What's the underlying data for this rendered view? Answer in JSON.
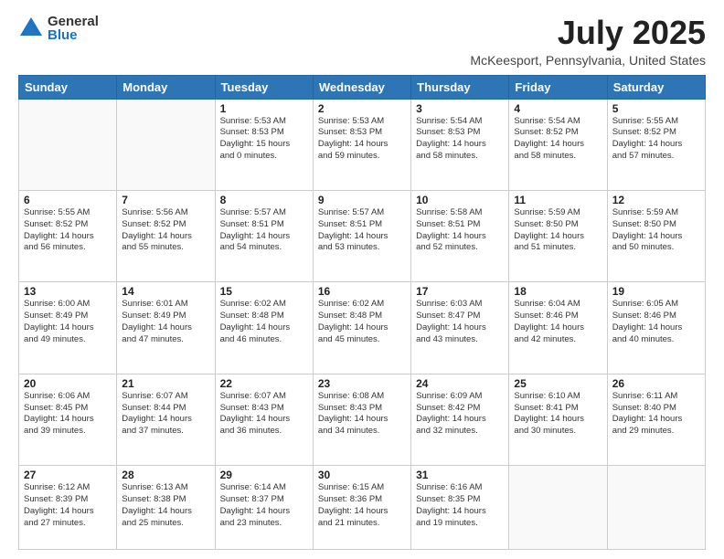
{
  "logo": {
    "general": "General",
    "blue": "Blue"
  },
  "title": "July 2025",
  "subtitle": "McKeesport, Pennsylvania, United States",
  "weekdays": [
    "Sunday",
    "Monday",
    "Tuesday",
    "Wednesday",
    "Thursday",
    "Friday",
    "Saturday"
  ],
  "weeks": [
    [
      {
        "day": null,
        "info": null
      },
      {
        "day": null,
        "info": null
      },
      {
        "day": "1",
        "info": "Sunrise: 5:53 AM\nSunset: 8:53 PM\nDaylight: 15 hours\nand 0 minutes."
      },
      {
        "day": "2",
        "info": "Sunrise: 5:53 AM\nSunset: 8:53 PM\nDaylight: 14 hours\nand 59 minutes."
      },
      {
        "day": "3",
        "info": "Sunrise: 5:54 AM\nSunset: 8:53 PM\nDaylight: 14 hours\nand 58 minutes."
      },
      {
        "day": "4",
        "info": "Sunrise: 5:54 AM\nSunset: 8:52 PM\nDaylight: 14 hours\nand 58 minutes."
      },
      {
        "day": "5",
        "info": "Sunrise: 5:55 AM\nSunset: 8:52 PM\nDaylight: 14 hours\nand 57 minutes."
      }
    ],
    [
      {
        "day": "6",
        "info": "Sunrise: 5:55 AM\nSunset: 8:52 PM\nDaylight: 14 hours\nand 56 minutes."
      },
      {
        "day": "7",
        "info": "Sunrise: 5:56 AM\nSunset: 8:52 PM\nDaylight: 14 hours\nand 55 minutes."
      },
      {
        "day": "8",
        "info": "Sunrise: 5:57 AM\nSunset: 8:51 PM\nDaylight: 14 hours\nand 54 minutes."
      },
      {
        "day": "9",
        "info": "Sunrise: 5:57 AM\nSunset: 8:51 PM\nDaylight: 14 hours\nand 53 minutes."
      },
      {
        "day": "10",
        "info": "Sunrise: 5:58 AM\nSunset: 8:51 PM\nDaylight: 14 hours\nand 52 minutes."
      },
      {
        "day": "11",
        "info": "Sunrise: 5:59 AM\nSunset: 8:50 PM\nDaylight: 14 hours\nand 51 minutes."
      },
      {
        "day": "12",
        "info": "Sunrise: 5:59 AM\nSunset: 8:50 PM\nDaylight: 14 hours\nand 50 minutes."
      }
    ],
    [
      {
        "day": "13",
        "info": "Sunrise: 6:00 AM\nSunset: 8:49 PM\nDaylight: 14 hours\nand 49 minutes."
      },
      {
        "day": "14",
        "info": "Sunrise: 6:01 AM\nSunset: 8:49 PM\nDaylight: 14 hours\nand 47 minutes."
      },
      {
        "day": "15",
        "info": "Sunrise: 6:02 AM\nSunset: 8:48 PM\nDaylight: 14 hours\nand 46 minutes."
      },
      {
        "day": "16",
        "info": "Sunrise: 6:02 AM\nSunset: 8:48 PM\nDaylight: 14 hours\nand 45 minutes."
      },
      {
        "day": "17",
        "info": "Sunrise: 6:03 AM\nSunset: 8:47 PM\nDaylight: 14 hours\nand 43 minutes."
      },
      {
        "day": "18",
        "info": "Sunrise: 6:04 AM\nSunset: 8:46 PM\nDaylight: 14 hours\nand 42 minutes."
      },
      {
        "day": "19",
        "info": "Sunrise: 6:05 AM\nSunset: 8:46 PM\nDaylight: 14 hours\nand 40 minutes."
      }
    ],
    [
      {
        "day": "20",
        "info": "Sunrise: 6:06 AM\nSunset: 8:45 PM\nDaylight: 14 hours\nand 39 minutes."
      },
      {
        "day": "21",
        "info": "Sunrise: 6:07 AM\nSunset: 8:44 PM\nDaylight: 14 hours\nand 37 minutes."
      },
      {
        "day": "22",
        "info": "Sunrise: 6:07 AM\nSunset: 8:43 PM\nDaylight: 14 hours\nand 36 minutes."
      },
      {
        "day": "23",
        "info": "Sunrise: 6:08 AM\nSunset: 8:43 PM\nDaylight: 14 hours\nand 34 minutes."
      },
      {
        "day": "24",
        "info": "Sunrise: 6:09 AM\nSunset: 8:42 PM\nDaylight: 14 hours\nand 32 minutes."
      },
      {
        "day": "25",
        "info": "Sunrise: 6:10 AM\nSunset: 8:41 PM\nDaylight: 14 hours\nand 30 minutes."
      },
      {
        "day": "26",
        "info": "Sunrise: 6:11 AM\nSunset: 8:40 PM\nDaylight: 14 hours\nand 29 minutes."
      }
    ],
    [
      {
        "day": "27",
        "info": "Sunrise: 6:12 AM\nSunset: 8:39 PM\nDaylight: 14 hours\nand 27 minutes."
      },
      {
        "day": "28",
        "info": "Sunrise: 6:13 AM\nSunset: 8:38 PM\nDaylight: 14 hours\nand 25 minutes."
      },
      {
        "day": "29",
        "info": "Sunrise: 6:14 AM\nSunset: 8:37 PM\nDaylight: 14 hours\nand 23 minutes."
      },
      {
        "day": "30",
        "info": "Sunrise: 6:15 AM\nSunset: 8:36 PM\nDaylight: 14 hours\nand 21 minutes."
      },
      {
        "day": "31",
        "info": "Sunrise: 6:16 AM\nSunset: 8:35 PM\nDaylight: 14 hours\nand 19 minutes."
      },
      {
        "day": null,
        "info": null
      },
      {
        "day": null,
        "info": null
      }
    ]
  ]
}
